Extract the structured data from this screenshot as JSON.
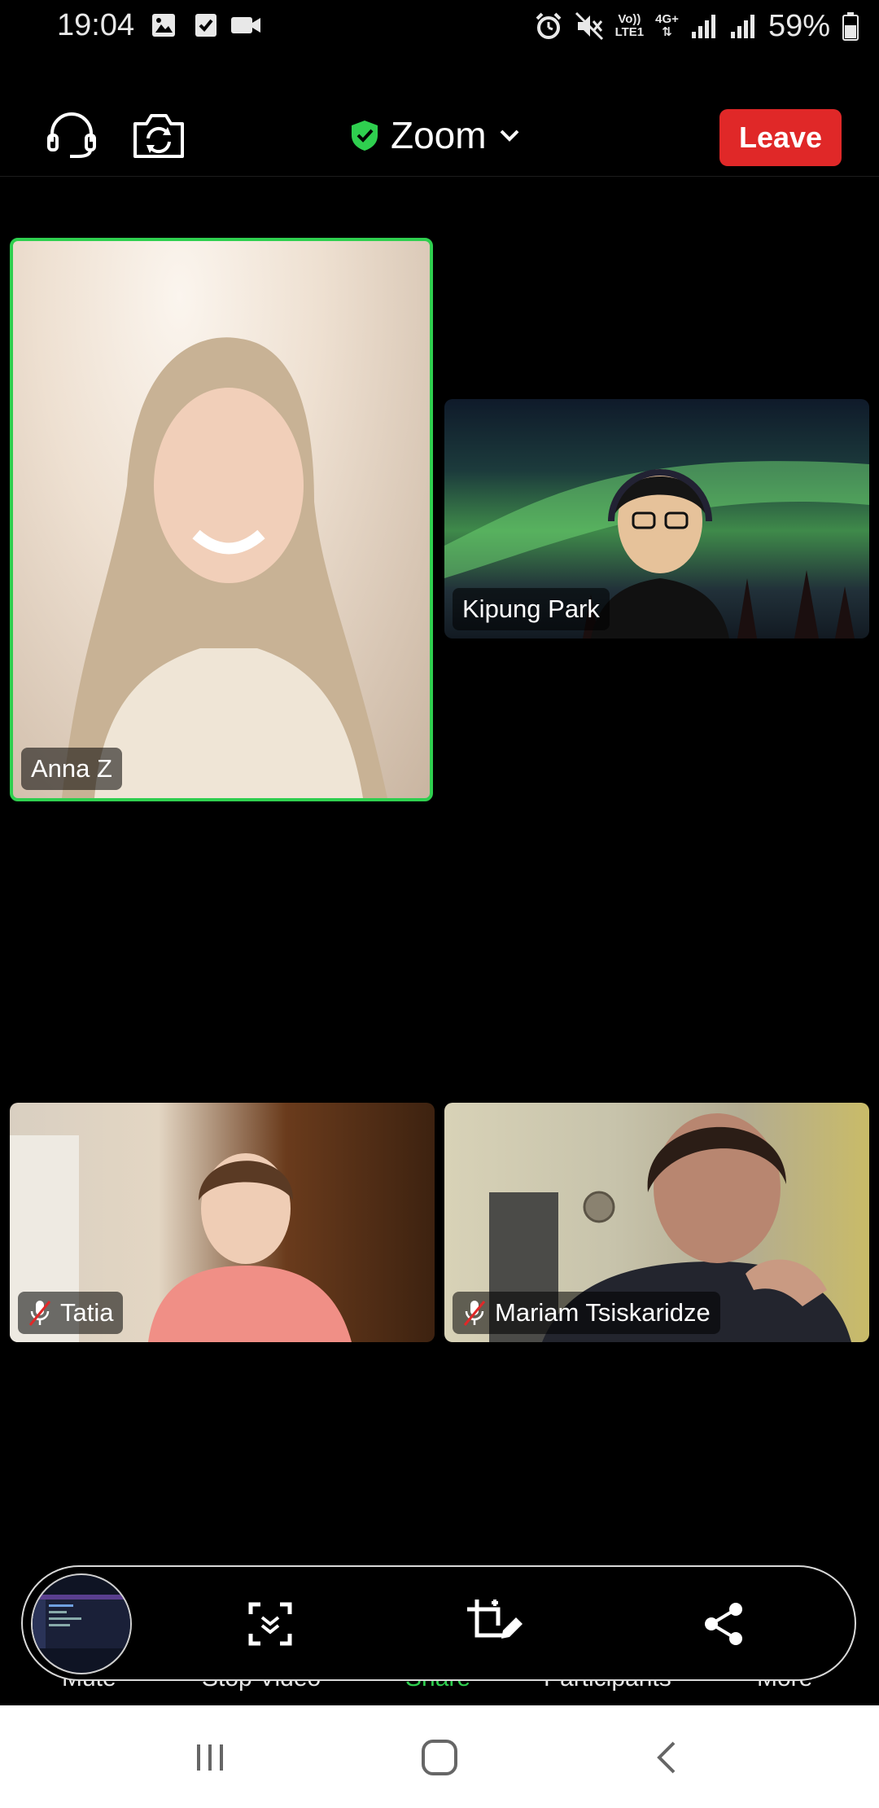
{
  "status_bar": {
    "time": "19:04",
    "network_top": "Vo))",
    "network_bottom": "LTE1",
    "network_type": "4G+",
    "battery": "59%"
  },
  "top_bar": {
    "title": "Zoom",
    "leave_label": "Leave"
  },
  "participants": [
    {
      "name": "Anna Z",
      "muted": false,
      "active_speaker": true
    },
    {
      "name": "Kipung Park",
      "muted": false,
      "active_speaker": false
    },
    {
      "name": "Tatia",
      "muted": true,
      "active_speaker": false
    },
    {
      "name": "Mariam Tsiskaridze",
      "muted": true,
      "active_speaker": false
    }
  ],
  "bottom_toolbar": {
    "labels": [
      "Mute",
      "Stop Video",
      "Share",
      "Participants",
      "More"
    ]
  },
  "share_pill": {
    "icons": [
      "screen-preview",
      "capture-screen-icon",
      "annotate-icon",
      "share-icon"
    ]
  },
  "colors": {
    "active_speaker_border": "#2fcf4f",
    "leave_button": "#e02828",
    "share_label": "#2fcf4f",
    "encryption_shield": "#2fcf4f"
  }
}
